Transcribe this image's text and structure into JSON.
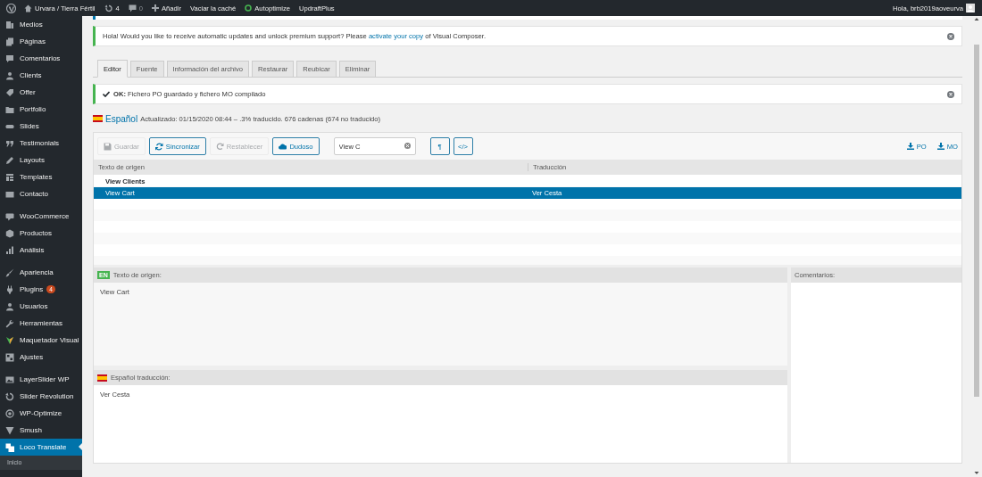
{
  "admin_bar": {
    "site": "Urvara / Tierra Fértil",
    "updates": "4",
    "comments": "0",
    "new": "Añadir",
    "items": [
      {
        "label": "Vaciar la caché",
        "kind": "link"
      },
      {
        "label": "Autoptimize",
        "kind": "status"
      },
      {
        "label": "UpdraftPlus",
        "kind": "link"
      }
    ],
    "greeting": "Hola, brb2019aoveurva"
  },
  "sidebar": {
    "groups": [
      {
        "items": [
          {
            "label": "Medios",
            "selected": false
          },
          {
            "label": "Páginas",
            "selected": false
          },
          {
            "label": "Comentarios",
            "selected": false
          },
          {
            "label": "Clients",
            "selected": false
          },
          {
            "label": "Offer",
            "selected": false
          },
          {
            "label": "Portfolio",
            "selected": false
          },
          {
            "label": "Slides",
            "selected": false
          },
          {
            "label": "Testimonials",
            "selected": false
          },
          {
            "label": "Layouts",
            "selected": false
          },
          {
            "label": "Templates",
            "selected": false
          },
          {
            "label": "Contacto",
            "selected": false
          }
        ]
      },
      {
        "items": [
          {
            "label": "WooCommerce",
            "selected": false
          },
          {
            "label": "Productos",
            "selected": false
          },
          {
            "label": "Análisis",
            "selected": false
          }
        ]
      },
      {
        "items": [
          {
            "label": "Apariencia",
            "selected": false
          },
          {
            "label": "Plugins",
            "selected": false,
            "badge": "4"
          },
          {
            "label": "Usuarios",
            "selected": false
          },
          {
            "label": "Herramientas",
            "selected": false
          },
          {
            "label": "Maquetador Visual",
            "selected": false
          },
          {
            "label": "Ajustes",
            "selected": false
          }
        ]
      },
      {
        "items": [
          {
            "label": "LayerSlider WP",
            "selected": false
          },
          {
            "label": "Slider Revolution",
            "selected": false
          },
          {
            "label": "WP-Optimize",
            "selected": false
          },
          {
            "label": "Smush",
            "selected": false
          },
          {
            "label": "Loco Translate",
            "selected": true,
            "submenu": [
              {
                "label": "Inicio"
              }
            ]
          }
        ]
      }
    ]
  },
  "notices": [
    {
      "kind": "info",
      "text": "Hola! Would you like to receive automatic updates and unlock premium support? Please ",
      "link": "activate your copy",
      "after": " of Visual Composer.",
      "dismissible": true
    },
    {
      "kind": "success",
      "text": "**OK:** Fichero PO guardado y fichero MO compilado",
      "dismissible": true
    }
  ],
  "tabs": [
    {
      "label": "Editor",
      "selected": true
    },
    {
      "label": "Fuente",
      "selected": false
    },
    {
      "label": "Información del archivo",
      "selected": false
    },
    {
      "label": "Restaurar",
      "selected": false
    },
    {
      "label": "Reubicar",
      "selected": false
    },
    {
      "label": "Eliminar",
      "selected": false
    }
  ],
  "language": {
    "name": "Español",
    "meta": "Actualizado: 01/15/2020 08:44 – .3% traducido. 676 cadenas (674 no traducido)"
  },
  "editor": {
    "toolbar": {
      "buttons": [
        {
          "label": "Guardar",
          "kind": "save",
          "disabled": true
        },
        {
          "label": "Sincronizar",
          "kind": "sync",
          "disabled": false
        },
        {
          "label": "Restablecer",
          "kind": "revert",
          "disabled": true
        },
        {
          "label": "Dudoso",
          "kind": "fuzzy",
          "disabled": false
        }
      ],
      "search": {
        "value": "View C"
      },
      "toggles": [
        {
          "label": "¶"
        },
        {
          "label": "</>"
        }
      ],
      "downloads": [
        "PO",
        "MO"
      ]
    },
    "columns": [
      "Texto de origen",
      "Traducción"
    ],
    "rows": [
      {
        "source": "View Clients",
        "translated": false,
        "selected": false
      },
      {
        "source": "View Cart",
        "translation": "Ver Cesta",
        "translated": true,
        "selected": true
      }
    ],
    "source_pane": {
      "badge": "EN",
      "title": "Texto de origen:",
      "text": "View Cart"
    },
    "translation_pane": {
      "title": "Español traducción:",
      "text": "Ver Cesta"
    },
    "comments_pane": {
      "title": "Comentarios:"
    }
  }
}
